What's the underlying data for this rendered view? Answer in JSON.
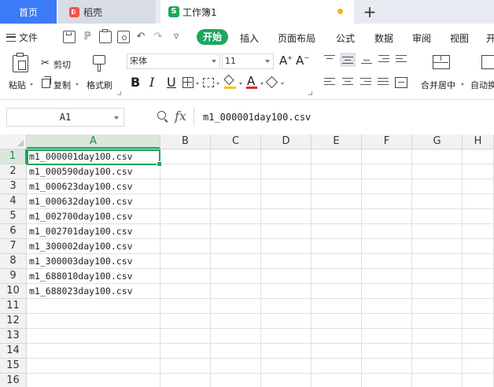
{
  "tabs": {
    "home": "首页",
    "daoke": "稻壳",
    "workbook": "工作簿1",
    "workbook_icon": "S",
    "new_tab": "+"
  },
  "menu": {
    "file": "文件",
    "start": "开始",
    "items": [
      "插入",
      "页面布局",
      "公式",
      "数据",
      "审阅",
      "视图",
      "开"
    ]
  },
  "ribbon": {
    "paste": "粘贴",
    "cut": "剪切",
    "copy": "复制",
    "format_painter": "格式刷",
    "font_name": "宋体",
    "font_size": "11",
    "bold": "B",
    "italic": "I",
    "underline": "U",
    "merge_center": "合并居中",
    "auto_wrap": "自动换"
  },
  "formula_bar": {
    "cell_ref": "A1",
    "fx": "fx",
    "content": "m1_000001day100.csv"
  },
  "grid": {
    "columns": [
      "A",
      "B",
      "C",
      "D",
      "E",
      "F",
      "G",
      "H"
    ],
    "rows": [
      {
        "num": "1",
        "a": "m1_000001day100.csv"
      },
      {
        "num": "2",
        "a": "m1_000590day100.csv"
      },
      {
        "num": "3",
        "a": "m1_000623day100.csv"
      },
      {
        "num": "4",
        "a": "m1_000632day100.csv"
      },
      {
        "num": "5",
        "a": "m1_002700day100.csv"
      },
      {
        "num": "6",
        "a": "m1_002701day100.csv"
      },
      {
        "num": "7",
        "a": "m1_300002day100.csv"
      },
      {
        "num": "8",
        "a": "m1_300003day100.csv"
      },
      {
        "num": "9",
        "a": "m1_688010day100.csv"
      },
      {
        "num": "10",
        "a": "m1_688023day100.csv"
      },
      {
        "num": "11",
        "a": ""
      },
      {
        "num": "12",
        "a": ""
      },
      {
        "num": "13",
        "a": ""
      },
      {
        "num": "14",
        "a": ""
      },
      {
        "num": "15",
        "a": ""
      },
      {
        "num": "16",
        "a": ""
      }
    ]
  },
  "colors": {
    "accent_green": "#1fa65c",
    "home_tab_blue": "#3b7bf6",
    "daoke_red": "#f0524a",
    "unsaved_dot": "#f5b31a"
  }
}
